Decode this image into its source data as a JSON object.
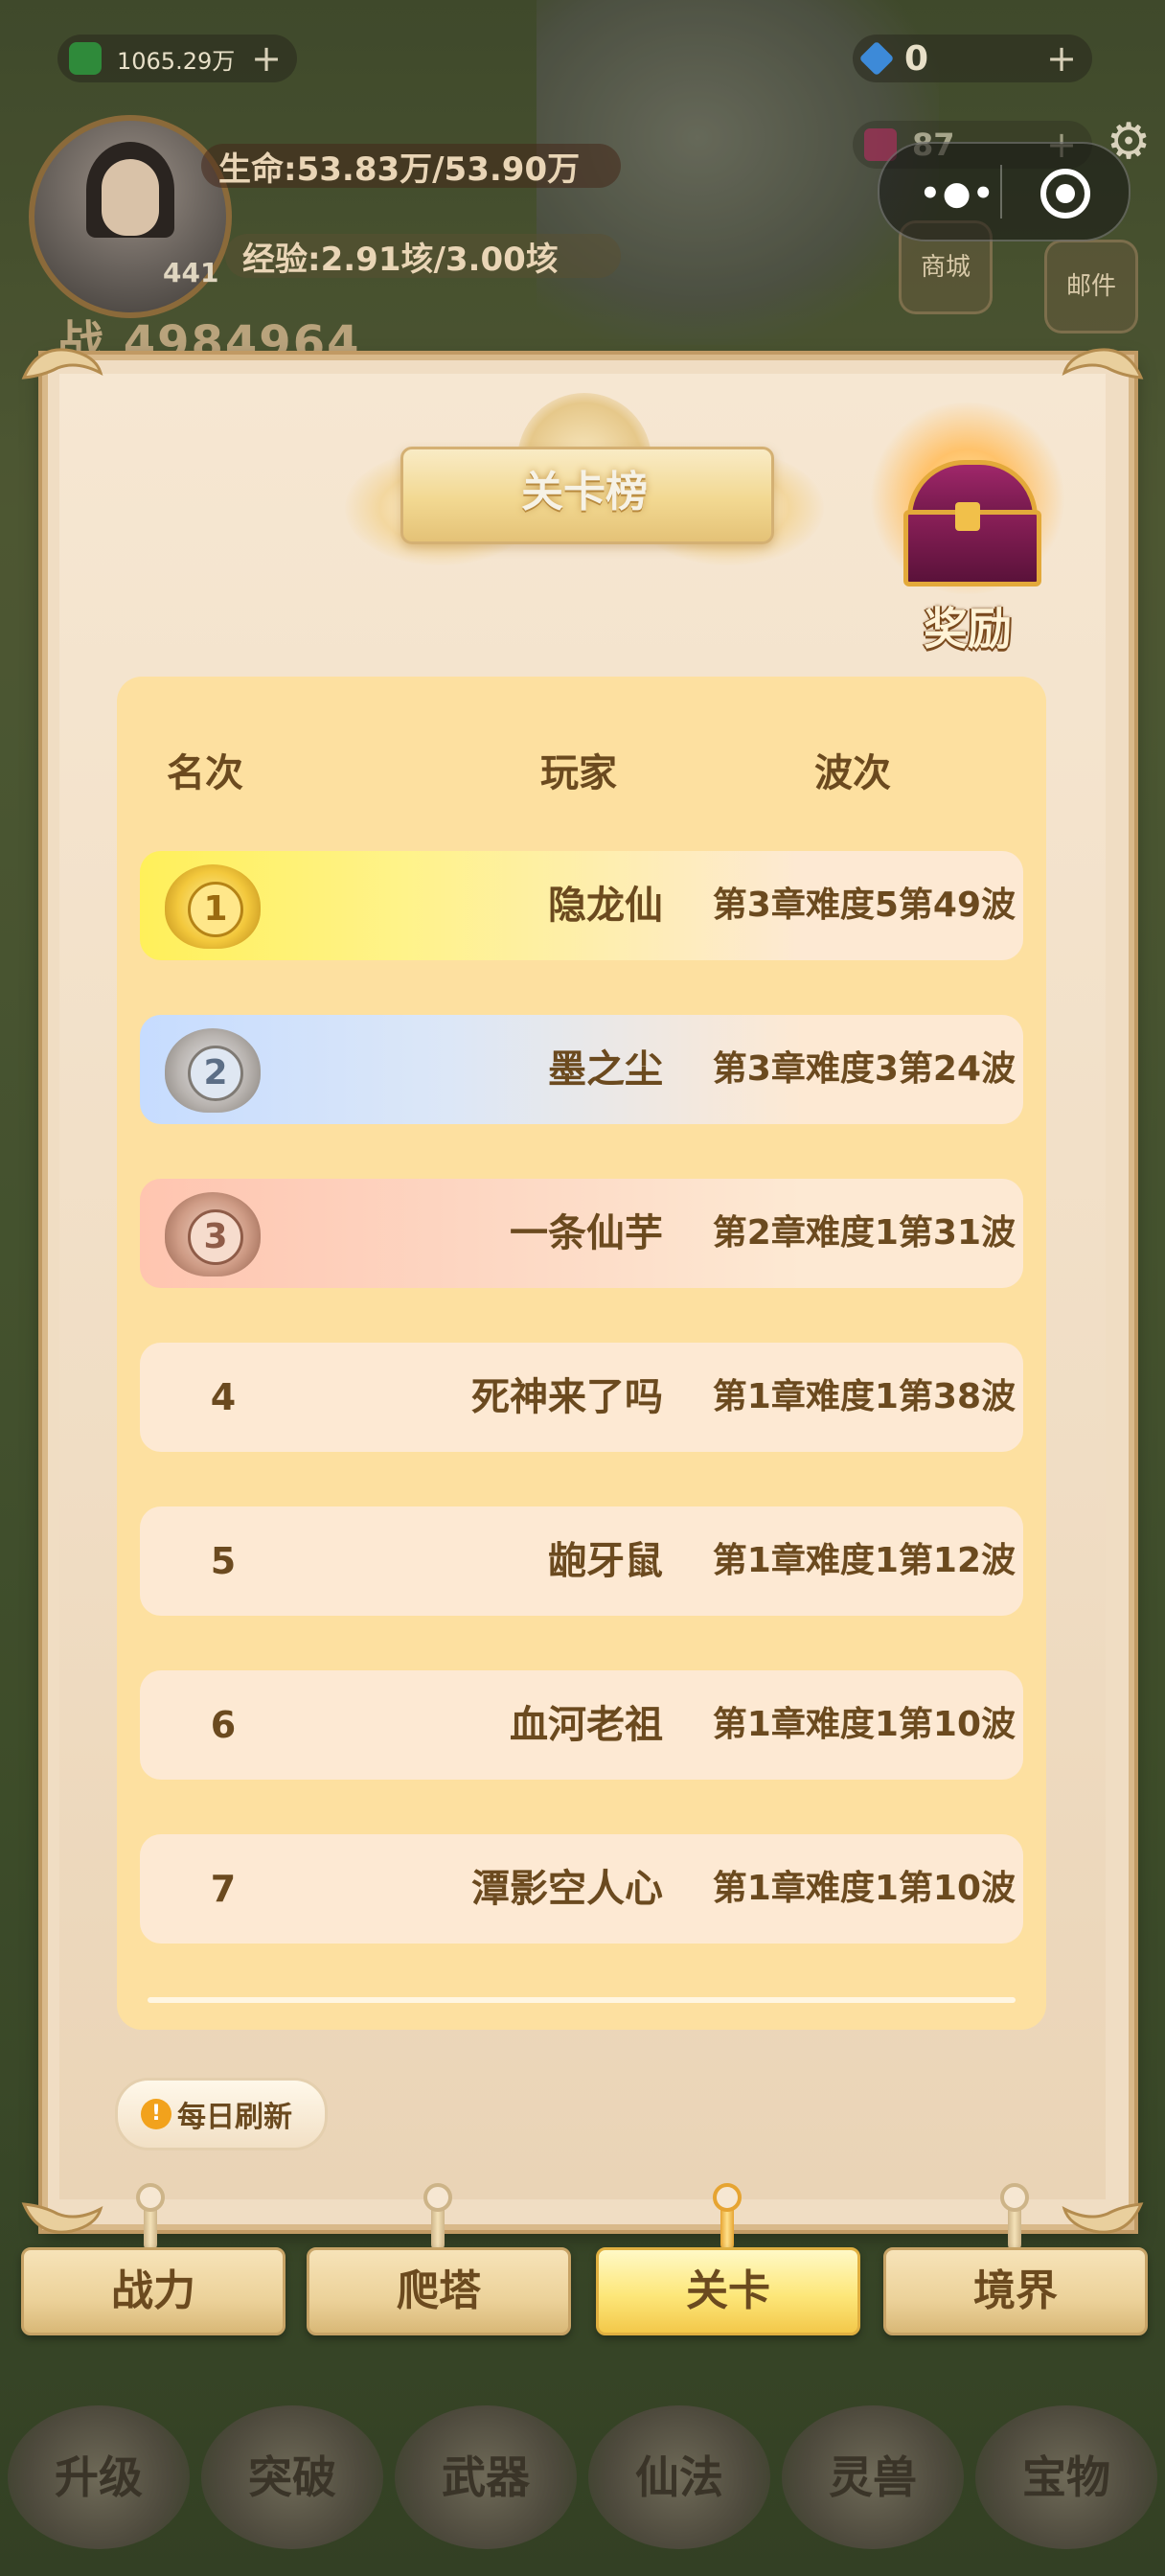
{
  "hud": {
    "currency_gold": "1065.29万",
    "currency_gem": "0",
    "currency_other": "87",
    "hp_text": "生命:53.83万/53.90万",
    "exp_text": "经验:2.91垓/3.00垓",
    "level": "441",
    "power_text": "战 4984964",
    "side_shop": "商城",
    "side_mail": "邮件"
  },
  "panel": {
    "title": "关卡榜",
    "reward_label": "奖励",
    "columns": {
      "rank": "名次",
      "player": "玩家",
      "wave": "波次"
    },
    "rows": [
      {
        "rank": "1",
        "name": "隐龙仙",
        "wave": "第3章难度5第49波"
      },
      {
        "rank": "2",
        "name": "墨之尘",
        "wave": "第3章难度3第24波"
      },
      {
        "rank": "3",
        "name": "一条仙芋",
        "wave": "第2章难度1第31波"
      },
      {
        "rank": "4",
        "name": "死神来了吗",
        "wave": "第1章难度1第38波"
      },
      {
        "rank": "5",
        "name": "龅牙鼠",
        "wave": "第1章难度1第12波"
      },
      {
        "rank": "6",
        "name": "血河老祖",
        "wave": "第1章难度1第10波"
      },
      {
        "rank": "7",
        "name": "潭影空人心",
        "wave": "第1章难度1第10波"
      }
    ],
    "daily_refresh": "每日刷新",
    "daily_icon": "!"
  },
  "tabs": [
    "战力",
    "爬塔",
    "关卡",
    "境界"
  ],
  "active_tab": "关卡",
  "bottom_menu": [
    "升级",
    "突破",
    "武器",
    "仙法",
    "灵兽",
    "宝物"
  ],
  "colors": {
    "panel_bg": "#f0ddc4",
    "board_bg": "#fde0a0",
    "text_brown": "#6b4a1f",
    "gold_row": "#fff05a",
    "silver_row": "#c6dcff",
    "bronze_row": "#ffc5b0"
  }
}
